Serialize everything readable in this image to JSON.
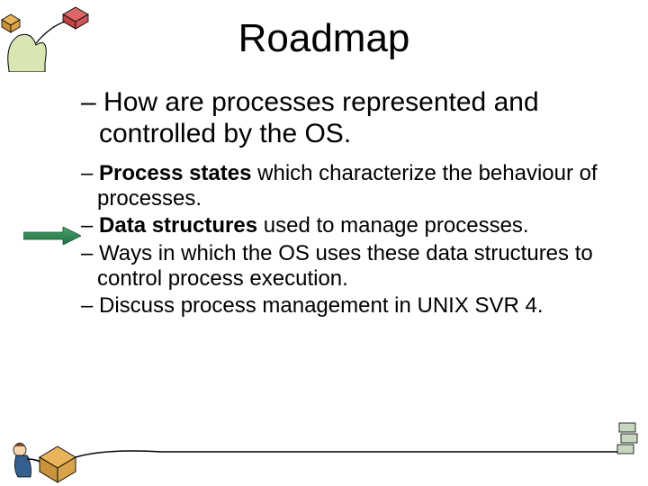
{
  "title": "Roadmap",
  "bullets": {
    "b1": {
      "prefix": "– ",
      "text": "How are processes represented and controlled by the OS."
    },
    "b2": {
      "prefix": "– ",
      "bold": "Process states",
      "rest": " which characterize the behaviour of processes."
    },
    "b3": {
      "prefix": "– ",
      "bold": "Data structures",
      "rest": " used to manage processes."
    },
    "b4": {
      "prefix": "– ",
      "text": "Ways in which the OS uses these data structures to control process execution."
    },
    "b5": {
      "prefix": "– ",
      "text": "Discuss process management in UNIX SVR 4."
    }
  }
}
